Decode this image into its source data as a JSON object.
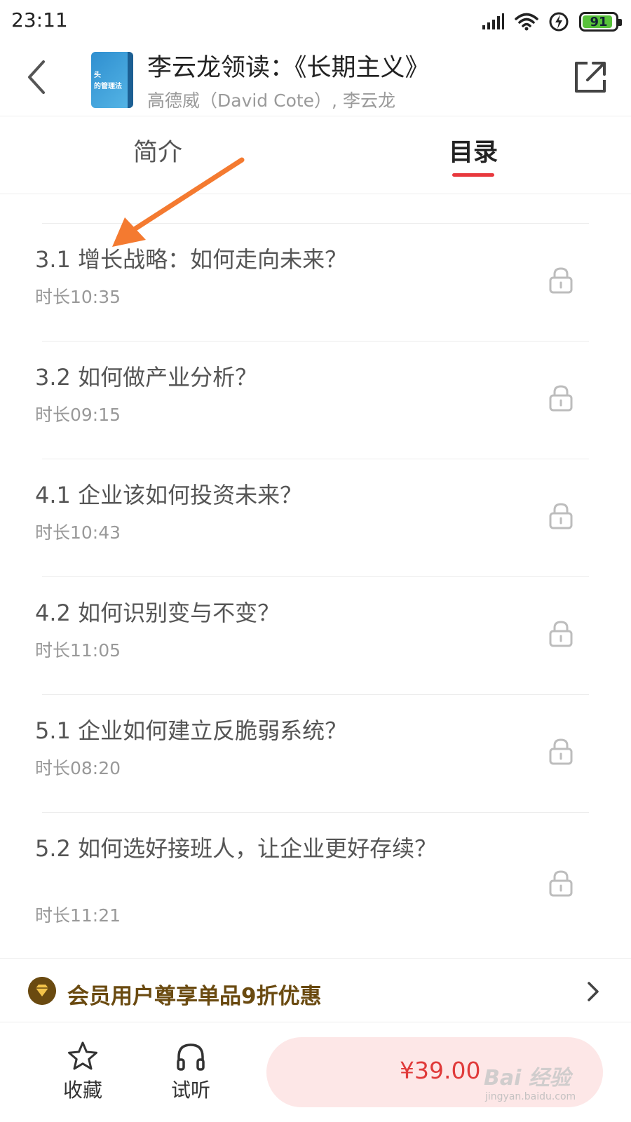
{
  "status_bar": {
    "time": "23:11",
    "battery_level": "91",
    "battery_percent": 91,
    "icons": [
      "signal-icon",
      "wifi-icon",
      "charging-icon",
      "battery-icon"
    ]
  },
  "header": {
    "back_icon": "chevron-left-icon",
    "cover_text_line1": "头",
    "cover_text_line2": "的管理法",
    "title": "李云龙领读：《长期主义》",
    "author": "高德威（David Cote）, 李云龙",
    "share_icon": "share-icon"
  },
  "tabs": {
    "intro": "简介",
    "catalog": "目录",
    "active": "catalog",
    "accent_color": "#e8383d"
  },
  "chapters": [
    {
      "title": "3.1 增长战略：如何走向未来？",
      "duration": "时长10:35",
      "locked": true
    },
    {
      "title": "3.2 如何做产业分析？",
      "duration": "时长09:15",
      "locked": true
    },
    {
      "title": "4.1 企业该如何投资未来？",
      "duration": "时长10:43",
      "locked": true
    },
    {
      "title": "4.2 如何识别变与不变？",
      "duration": "时长11:05",
      "locked": true
    },
    {
      "title": "5.1 企业如何建立反脆弱系统？",
      "duration": "时长08:20",
      "locked": true
    },
    {
      "title": "5.2 如何选好接班人，让企业更好存续？",
      "duration": "时长11:21",
      "locked": true
    }
  ],
  "member_banner": {
    "text": "会员用户尊享单品9折优惠",
    "icon": "diamond-badge-icon",
    "color": "#6a4a10"
  },
  "bottom_bar": {
    "favorite_label": "收藏",
    "favorite_icon": "star-icon",
    "listen_label": "试听",
    "listen_icon": "headphones-icon",
    "price": "¥39.00",
    "price_color": "#e03a3a"
  },
  "watermark": {
    "text": "Bai 经验",
    "sub": "jingyan.baidu.com"
  },
  "annotation": {
    "arrow_color": "#f47a30"
  }
}
